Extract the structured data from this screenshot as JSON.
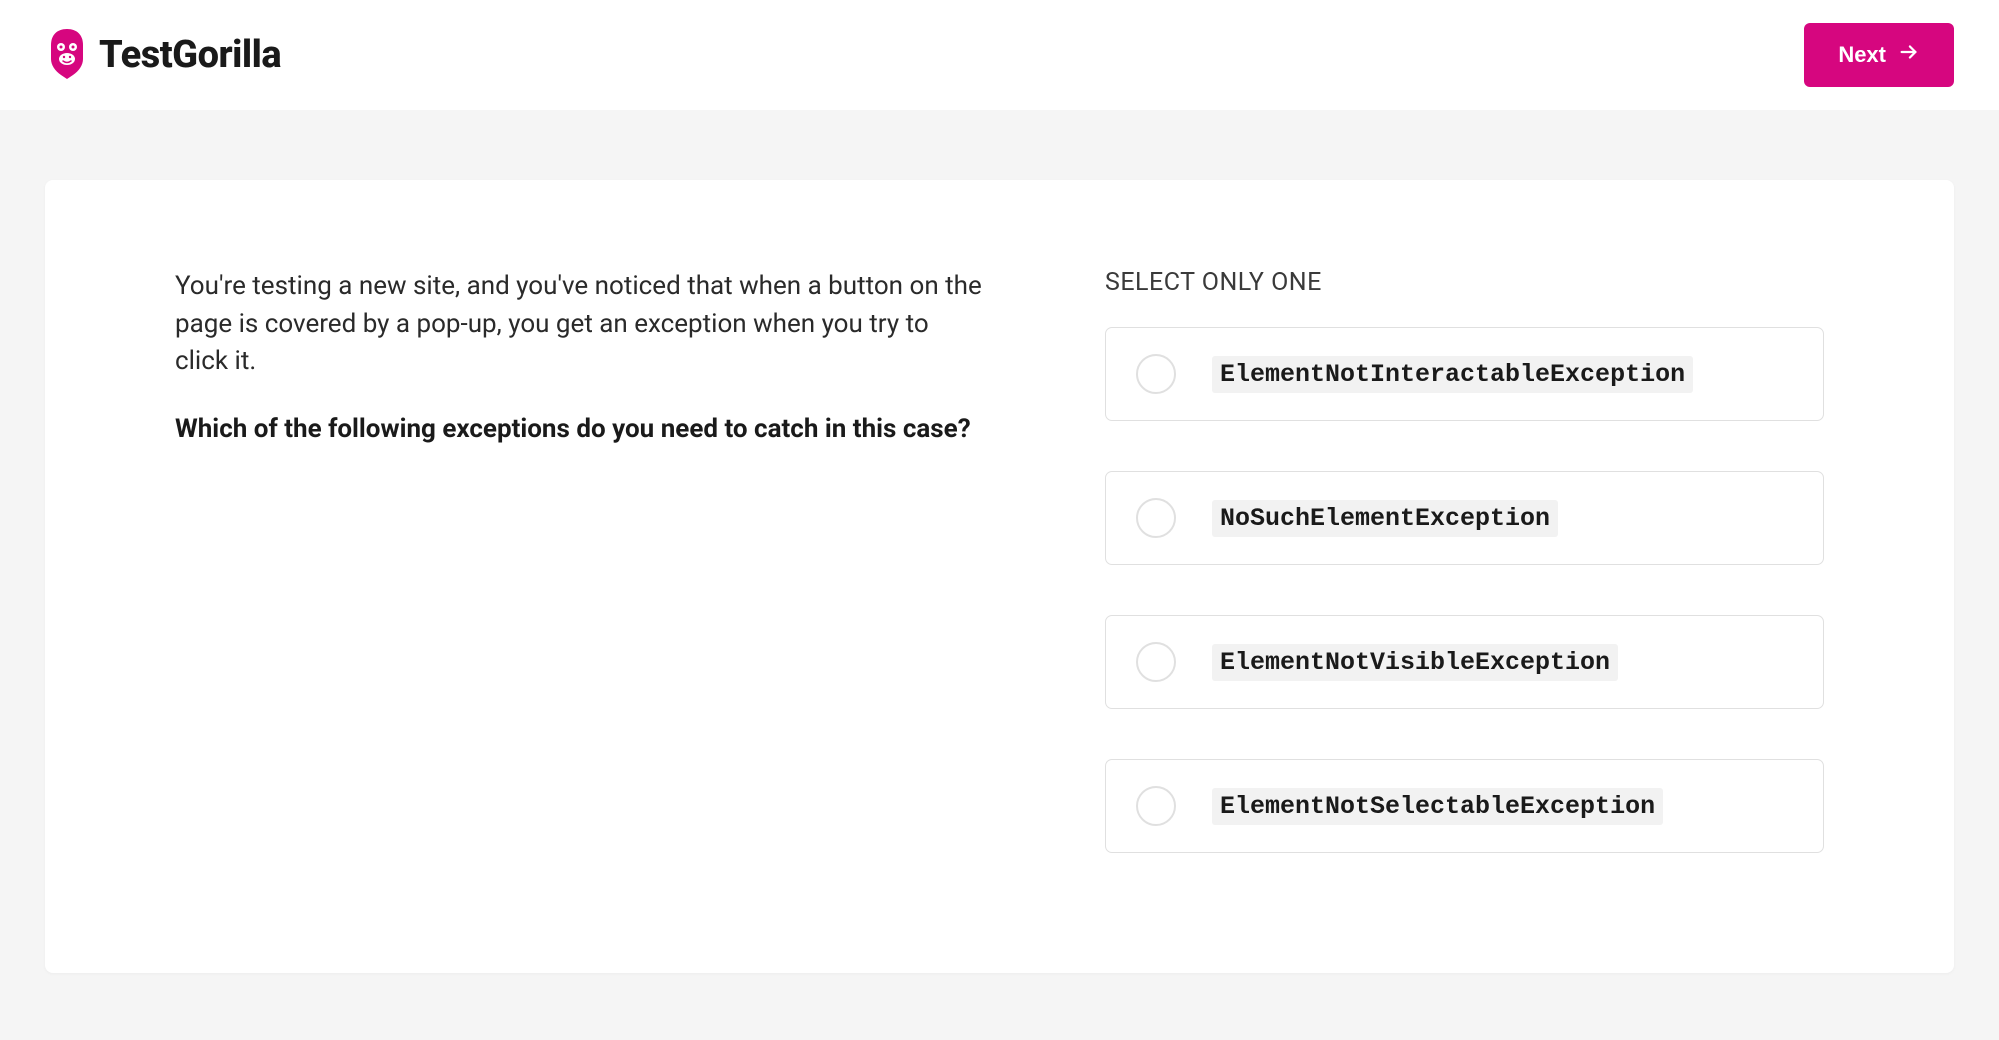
{
  "header": {
    "brand_name": "TestGorilla",
    "next_label": "Next"
  },
  "question": {
    "intro": "You're testing a new site, and you've noticed that when a button on the page is covered by a pop-up, you get an exception when you try to click it.",
    "prompt": "Which of the following exceptions do you need to catch in this case?"
  },
  "answers": {
    "instruction": "SELECT ONLY ONE",
    "options": [
      "ElementNotInteractableException",
      "NoSuchElementException",
      "ElementNotVisibleException",
      "ElementNotSelectableException"
    ]
  },
  "colors": {
    "accent": "#d6067f"
  }
}
